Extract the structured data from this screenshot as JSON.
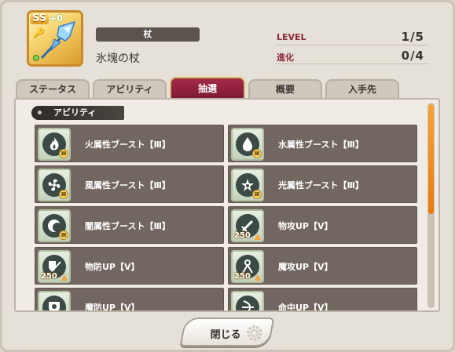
{
  "item": {
    "rarity": "SS",
    "plus": "+0",
    "type": "杖",
    "name": "氷塊の杖",
    "icon": "ice-staff-icon"
  },
  "stats": [
    {
      "label": "LEVEL",
      "value": "1/5"
    },
    {
      "label": "進化",
      "value": "0/4"
    }
  ],
  "tabs": [
    {
      "label": "ステータス",
      "active": false
    },
    {
      "label": "アビリティ",
      "active": false
    },
    {
      "label": "抽選",
      "active": true
    },
    {
      "label": "概要",
      "active": false
    },
    {
      "label": "入手先",
      "active": false
    }
  ],
  "section": {
    "title": "アビリティ"
  },
  "abilities": [
    {
      "label": "火属性ブースト【Ⅲ】",
      "icon": "fire-icon",
      "badge": "Ⅲ"
    },
    {
      "label": "水属性ブースト【Ⅲ】",
      "icon": "water-drop-icon",
      "badge": "Ⅲ"
    },
    {
      "label": "風属性ブースト【Ⅲ】",
      "icon": "wind-icon",
      "badge": "Ⅲ"
    },
    {
      "label": "光属性ブースト【Ⅲ】",
      "icon": "light-icon",
      "badge": "Ⅲ"
    },
    {
      "label": "闇属性ブースト【Ⅲ】",
      "icon": "dark-moon-icon",
      "badge": "Ⅲ"
    },
    {
      "label": "物攻UP【V】",
      "icon": "sword-icon",
      "badge": "250"
    },
    {
      "label": "物防UP【V】",
      "icon": "shield-sword-icon",
      "badge": "250"
    },
    {
      "label": "魔攻UP【V】",
      "icon": "magic-staff-icon",
      "badge": "250"
    },
    {
      "label": "魔防UP【V】",
      "icon": "magic-shield-icon",
      "badge": ""
    },
    {
      "label": "命中UP【V】",
      "icon": "bow-icon",
      "badge": ""
    }
  ],
  "close_button": {
    "label": "閉じる"
  },
  "colors": {
    "accent_tab": "#8e2140",
    "scroll_thumb": "#f09225",
    "card_bg": "#726760"
  }
}
